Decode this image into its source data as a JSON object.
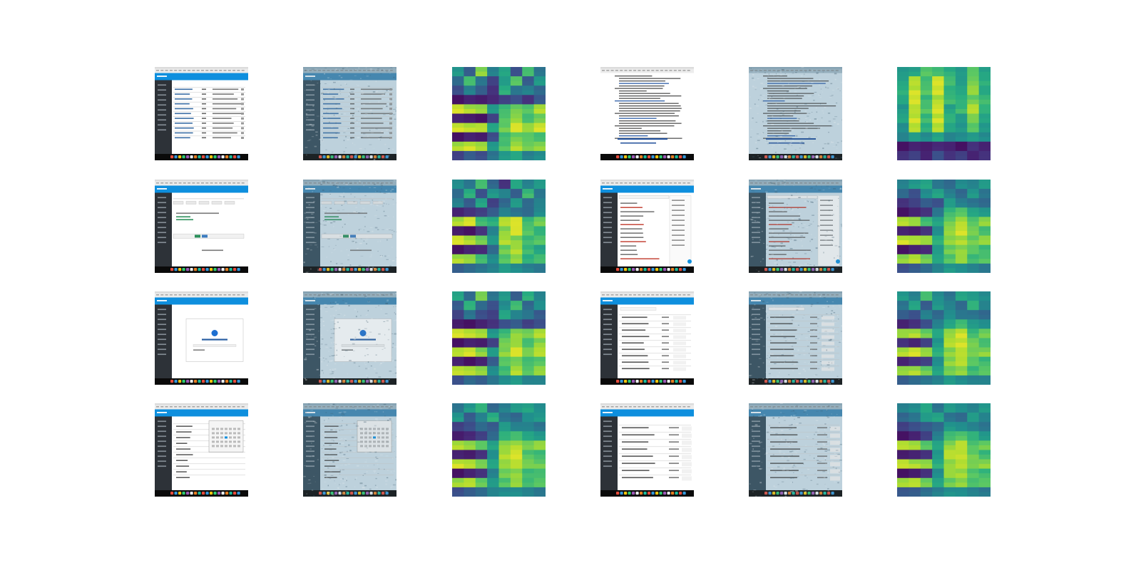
{
  "figure": {
    "rows": 4,
    "panel_kinds_per_row": [
      "screenshot",
      "screenshot-noisy",
      "heatmap",
      "screenshot",
      "screenshot-noisy",
      "heatmap"
    ],
    "heatmap_colormap": "viridis",
    "heatmap_grid": {
      "rows": 10,
      "cols": 8
    },
    "heatmaps": [
      [
        [
          0.55,
          0.3,
          0.85,
          0.45,
          0.6,
          0.25,
          0.7,
          0.4
        ],
        [
          0.35,
          0.7,
          0.4,
          0.2,
          0.55,
          0.75,
          0.3,
          0.55
        ],
        [
          0.25,
          0.45,
          0.3,
          0.15,
          0.65,
          0.4,
          0.45,
          0.35
        ],
        [
          0.05,
          0.1,
          0.08,
          0.12,
          0.2,
          0.25,
          0.15,
          0.3
        ],
        [
          0.95,
          0.9,
          0.85,
          0.55,
          0.7,
          0.8,
          0.75,
          0.9
        ],
        [
          0.1,
          0.08,
          0.05,
          0.2,
          0.75,
          0.85,
          0.7,
          0.8
        ],
        [
          0.95,
          0.92,
          0.9,
          0.6,
          0.8,
          0.95,
          0.85,
          0.95
        ],
        [
          0.05,
          0.1,
          0.08,
          0.25,
          0.7,
          0.8,
          0.75,
          0.7
        ],
        [
          0.9,
          0.95,
          0.88,
          0.55,
          0.75,
          0.9,
          0.8,
          0.85
        ],
        [
          0.2,
          0.3,
          0.25,
          0.4,
          0.55,
          0.6,
          0.45,
          0.5
        ]
      ],
      [
        [
          0.55,
          0.6,
          0.75,
          0.7,
          0.65,
          0.55,
          0.75,
          0.6
        ],
        [
          0.6,
          0.9,
          0.7,
          0.95,
          0.7,
          0.55,
          0.8,
          0.65
        ],
        [
          0.65,
          0.95,
          0.75,
          0.95,
          0.65,
          0.6,
          0.85,
          0.6
        ],
        [
          0.6,
          0.95,
          0.7,
          0.9,
          0.7,
          0.65,
          0.8,
          0.7
        ],
        [
          0.55,
          0.9,
          0.75,
          0.95,
          0.6,
          0.7,
          0.9,
          0.65
        ],
        [
          0.6,
          0.95,
          0.7,
          0.95,
          0.65,
          0.55,
          0.8,
          0.6
        ],
        [
          0.5,
          0.9,
          0.65,
          0.9,
          0.6,
          0.55,
          0.75,
          0.55
        ],
        [
          0.45,
          0.55,
          0.5,
          0.6,
          0.45,
          0.5,
          0.55,
          0.5
        ],
        [
          0.05,
          0.1,
          0.08,
          0.12,
          0.1,
          0.05,
          0.15,
          0.1
        ],
        [
          0.15,
          0.2,
          0.1,
          0.25,
          0.15,
          0.2,
          0.1,
          0.15
        ]
      ],
      [
        [
          0.5,
          0.4,
          0.7,
          0.35,
          0.15,
          0.6,
          0.45,
          0.55
        ],
        [
          0.35,
          0.65,
          0.25,
          0.55,
          0.45,
          0.3,
          0.7,
          0.4
        ],
        [
          0.45,
          0.3,
          0.6,
          0.2,
          0.35,
          0.55,
          0.35,
          0.45
        ],
        [
          0.1,
          0.15,
          0.2,
          0.3,
          0.45,
          0.4,
          0.35,
          0.5
        ],
        [
          0.9,
          0.95,
          0.7,
          0.65,
          0.9,
          0.95,
          0.7,
          0.8
        ],
        [
          0.08,
          0.05,
          0.15,
          0.45,
          0.85,
          0.95,
          0.75,
          0.65
        ],
        [
          0.95,
          0.9,
          0.8,
          0.55,
          0.9,
          0.85,
          0.7,
          0.75
        ],
        [
          0.05,
          0.1,
          0.12,
          0.35,
          0.8,
          0.9,
          0.7,
          0.6
        ],
        [
          0.9,
          0.85,
          0.7,
          0.5,
          0.75,
          0.85,
          0.65,
          0.7
        ],
        [
          0.3,
          0.35,
          0.4,
          0.45,
          0.55,
          0.5,
          0.45,
          0.4
        ]
      ],
      [
        [
          0.45,
          0.55,
          0.6,
          0.4,
          0.35,
          0.5,
          0.45,
          0.55
        ],
        [
          0.35,
          0.25,
          0.5,
          0.6,
          0.45,
          0.35,
          0.55,
          0.4
        ],
        [
          0.15,
          0.2,
          0.3,
          0.25,
          0.55,
          0.45,
          0.4,
          0.35
        ],
        [
          0.05,
          0.1,
          0.15,
          0.4,
          0.7,
          0.75,
          0.6,
          0.55
        ],
        [
          0.9,
          0.85,
          0.7,
          0.6,
          0.8,
          0.9,
          0.75,
          0.85
        ],
        [
          0.1,
          0.08,
          0.15,
          0.5,
          0.85,
          0.95,
          0.8,
          0.7
        ],
        [
          0.95,
          0.9,
          0.85,
          0.65,
          0.85,
          0.9,
          0.8,
          0.85
        ],
        [
          0.05,
          0.1,
          0.12,
          0.55,
          0.8,
          0.85,
          0.75,
          0.7
        ],
        [
          0.85,
          0.9,
          0.8,
          0.6,
          0.75,
          0.85,
          0.7,
          0.75
        ],
        [
          0.25,
          0.3,
          0.35,
          0.45,
          0.55,
          0.5,
          0.45,
          0.4
        ]
      ],
      [
        [
          0.6,
          0.35,
          0.8,
          0.4,
          0.55,
          0.3,
          0.65,
          0.45
        ],
        [
          0.3,
          0.65,
          0.35,
          0.25,
          0.5,
          0.7,
          0.35,
          0.5
        ],
        [
          0.2,
          0.4,
          0.25,
          0.2,
          0.6,
          0.45,
          0.4,
          0.3
        ],
        [
          0.08,
          0.05,
          0.1,
          0.15,
          0.25,
          0.3,
          0.2,
          0.25
        ],
        [
          0.95,
          0.92,
          0.88,
          0.55,
          0.7,
          0.85,
          0.8,
          0.9
        ],
        [
          0.05,
          0.1,
          0.08,
          0.2,
          0.8,
          0.85,
          0.7,
          0.85
        ],
        [
          0.9,
          0.95,
          0.85,
          0.55,
          0.85,
          0.95,
          0.8,
          0.9
        ],
        [
          0.1,
          0.05,
          0.1,
          0.3,
          0.75,
          0.8,
          0.7,
          0.75
        ],
        [
          0.92,
          0.9,
          0.85,
          0.5,
          0.7,
          0.9,
          0.75,
          0.85
        ],
        [
          0.25,
          0.35,
          0.3,
          0.4,
          0.5,
          0.55,
          0.45,
          0.45
        ]
      ],
      [
        [
          0.55,
          0.45,
          0.7,
          0.5,
          0.4,
          0.6,
          0.55,
          0.5
        ],
        [
          0.4,
          0.6,
          0.3,
          0.55,
          0.45,
          0.35,
          0.65,
          0.45
        ],
        [
          0.3,
          0.25,
          0.45,
          0.35,
          0.5,
          0.4,
          0.4,
          0.35
        ],
        [
          0.1,
          0.15,
          0.25,
          0.45,
          0.6,
          0.7,
          0.55,
          0.5
        ],
        [
          0.85,
          0.9,
          0.8,
          0.6,
          0.85,
          0.95,
          0.7,
          0.8
        ],
        [
          0.15,
          0.1,
          0.2,
          0.55,
          0.9,
          0.95,
          0.8,
          0.7
        ],
        [
          0.9,
          0.95,
          0.85,
          0.65,
          0.85,
          0.9,
          0.8,
          0.85
        ],
        [
          0.1,
          0.15,
          0.2,
          0.5,
          0.85,
          0.9,
          0.75,
          0.7
        ],
        [
          0.85,
          0.9,
          0.8,
          0.6,
          0.8,
          0.85,
          0.7,
          0.75
        ],
        [
          0.3,
          0.35,
          0.4,
          0.45,
          0.55,
          0.5,
          0.45,
          0.45
        ]
      ],
      [
        [
          0.4,
          0.55,
          0.65,
          0.35,
          0.45,
          0.55,
          0.6,
          0.5
        ],
        [
          0.55,
          0.3,
          0.45,
          0.65,
          0.4,
          0.35,
          0.5,
          0.55
        ],
        [
          0.2,
          0.25,
          0.35,
          0.3,
          0.55,
          0.45,
          0.45,
          0.4
        ],
        [
          0.08,
          0.12,
          0.2,
          0.35,
          0.65,
          0.7,
          0.6,
          0.55
        ],
        [
          0.9,
          0.85,
          0.75,
          0.6,
          0.85,
          0.9,
          0.8,
          0.85
        ],
        [
          0.1,
          0.08,
          0.15,
          0.5,
          0.9,
          0.95,
          0.75,
          0.7
        ],
        [
          0.95,
          0.9,
          0.8,
          0.6,
          0.85,
          0.9,
          0.8,
          0.8
        ],
        [
          0.05,
          0.1,
          0.15,
          0.45,
          0.8,
          0.85,
          0.7,
          0.7
        ],
        [
          0.88,
          0.9,
          0.78,
          0.55,
          0.75,
          0.85,
          0.7,
          0.75
        ],
        [
          0.25,
          0.3,
          0.35,
          0.45,
          0.5,
          0.5,
          0.45,
          0.4
        ]
      ],
      [
        [
          0.45,
          0.5,
          0.6,
          0.4,
          0.55,
          0.5,
          0.45,
          0.55
        ],
        [
          0.35,
          0.4,
          0.55,
          0.6,
          0.4,
          0.35,
          0.55,
          0.45
        ],
        [
          0.2,
          0.25,
          0.3,
          0.35,
          0.55,
          0.5,
          0.45,
          0.4
        ],
        [
          0.05,
          0.1,
          0.2,
          0.45,
          0.7,
          0.75,
          0.65,
          0.55
        ],
        [
          0.9,
          0.88,
          0.75,
          0.6,
          0.85,
          0.9,
          0.75,
          0.8
        ],
        [
          0.08,
          0.1,
          0.15,
          0.55,
          0.9,
          0.92,
          0.8,
          0.7
        ],
        [
          0.92,
          0.9,
          0.85,
          0.65,
          0.85,
          0.9,
          0.8,
          0.85
        ],
        [
          0.05,
          0.08,
          0.15,
          0.5,
          0.85,
          0.88,
          0.75,
          0.7
        ],
        [
          0.88,
          0.9,
          0.8,
          0.6,
          0.8,
          0.85,
          0.72,
          0.75
        ],
        [
          0.28,
          0.3,
          0.38,
          0.45,
          0.52,
          0.5,
          0.45,
          0.42
        ]
      ]
    ],
    "colors": {
      "sky_blue": "#0e8fde",
      "dark_sidebar": "#2d3238",
      "taskbar": "#0a0a0a",
      "chrome_grey": "#dcdcdc",
      "page_white": "#ffffff",
      "noisy_tint": "#cfe0ea",
      "noisy_dark": "#334a58"
    }
  }
}
